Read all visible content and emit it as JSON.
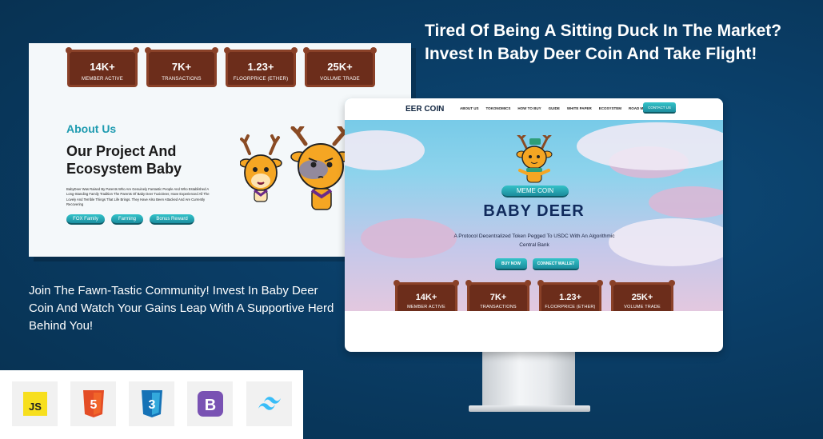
{
  "headline": "Tired Of Being A Sitting Duck In The Market? Invest In Baby Deer Coin And Take Flight!",
  "subtext": "Join The Fawn-Tastic Community! Invest In Baby Deer Coin And Watch Your Gains Leap With A Supportive Herd Behind You!",
  "stats": [
    {
      "value": "14K+",
      "label": "MEMBER ACTIVE"
    },
    {
      "value": "7K+",
      "label": "TRANSACTIONS"
    },
    {
      "value": "1.23+",
      "label": "FLOORPRICE (ETHER)"
    },
    {
      "value": "25K+",
      "label": "VOLUME TRADE"
    }
  ],
  "about": {
    "tag": "About Us",
    "title": "Our Project And Ecosystem Baby",
    "description": "BabyDeer Was Raised By Parents Who Are Genuinely Fantastic People And Who Established A Long-Standing Family Tradition The Parents Of Baby Deer TuxicDeer, Have Experienced All The Lovely And Terrible Things That Life Brings. They Have Also Been Attacked And Are Currently Recovering",
    "buttons": [
      "FOX Family",
      "Farming",
      "Bonus Reward"
    ]
  },
  "site": {
    "logo": "EER COIN",
    "nav": [
      "ABOUT US",
      "TOKONOMICS",
      "HOW TO BUY",
      "GUIDE",
      "WHITE PAPER",
      "ECOSYSTEM",
      "ROAD MAP"
    ],
    "contact": "CONTACT US",
    "meme_tag": "MEME COIN",
    "title": "BABY DEER",
    "description": "A Protocol Decentralized Token Pegged To USDC With An Algorithmic Central Bank",
    "buy": "BUY NOW",
    "connect": "CONNECT WALLET"
  },
  "tech": [
    {
      "name": "JavaScript",
      "glyph": "JS",
      "color": "#f7df1e"
    },
    {
      "name": "HTML5",
      "glyph": "5",
      "color": "#e44d26"
    },
    {
      "name": "CSS3",
      "glyph": "3",
      "color": "#1572b6"
    },
    {
      "name": "Bootstrap",
      "glyph": "B",
      "color": "#7952b3"
    },
    {
      "name": "Tailwind CSS",
      "glyph": "",
      "color": "#38bdf8"
    }
  ]
}
